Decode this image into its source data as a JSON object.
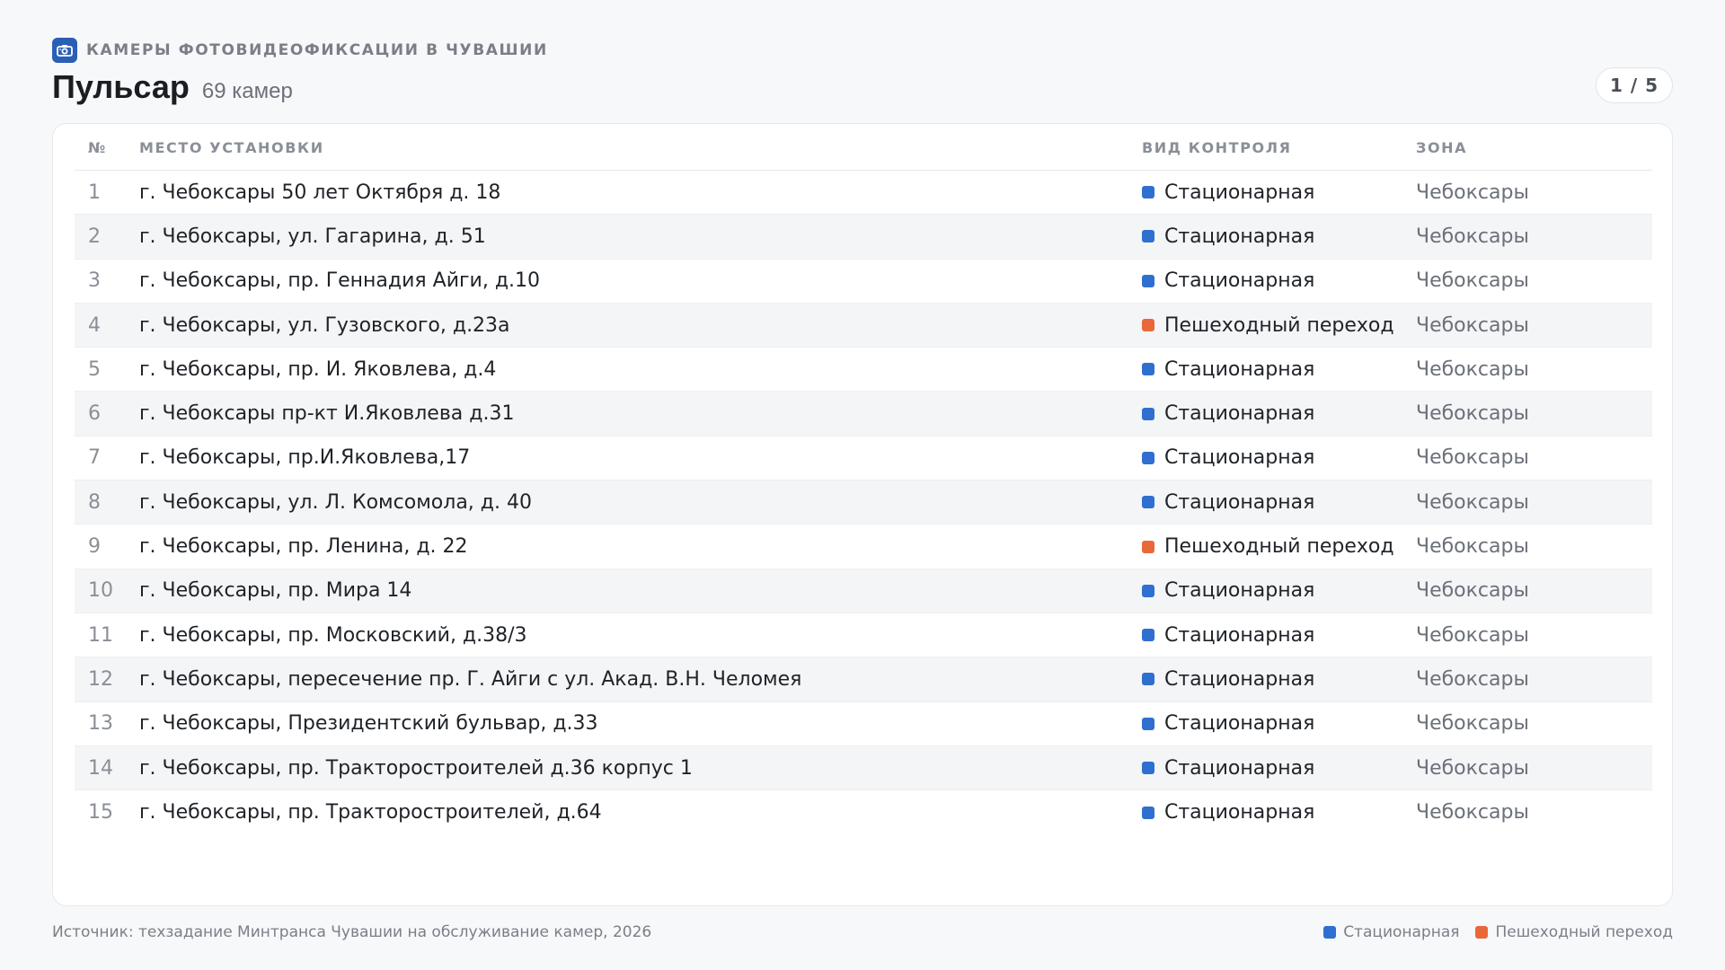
{
  "header": {
    "kicker": "КАМЕРЫ ФОТОВИДЕОФИКСАЦИИ В ЧУВАШИИ",
    "kicker_icon": "camera-icon",
    "title": "Пульсар",
    "count": "69 камер",
    "pager": "1 / 5"
  },
  "colors": {
    "stationary": "#2f6fd0",
    "crossing": "#e8683a",
    "brand": "#2b5fb6"
  },
  "table": {
    "columns": {
      "num": "№",
      "place": "МЕСТО УСТАНОВКИ",
      "type": "ВИД КОНТРОЛЯ",
      "zone": "ЗОНА"
    },
    "rows": [
      {
        "num": "1",
        "place": "г. Чебоксары 50 лет Октября д. 18",
        "type": "Стационарная",
        "kind": "stationary",
        "zone": "Чебоксары"
      },
      {
        "num": "2",
        "place": "г. Чебоксары, ул. Гагарина, д. 51",
        "type": "Стационарная",
        "kind": "stationary",
        "zone": "Чебоксары"
      },
      {
        "num": "3",
        "place": "г. Чебоксары, пр. Геннадия Айги, д.10",
        "type": "Стационарная",
        "kind": "stationary",
        "zone": "Чебоксары"
      },
      {
        "num": "4",
        "place": "г. Чебоксары, ул. Гузовского, д.23а",
        "type": "Пешеходный переход",
        "kind": "crossing",
        "zone": "Чебоксары"
      },
      {
        "num": "5",
        "place": "г. Чебоксары, пр. И. Яковлева, д.4",
        "type": "Стационарная",
        "kind": "stationary",
        "zone": "Чебоксары"
      },
      {
        "num": "6",
        "place": "г. Чебоксары пр-кт И.Яковлева д.31",
        "type": "Стационарная",
        "kind": "stationary",
        "zone": "Чебоксары"
      },
      {
        "num": "7",
        "place": "г. Чебоксары, пр.И.Яковлева,17",
        "type": "Стационарная",
        "kind": "stationary",
        "zone": "Чебоксары"
      },
      {
        "num": "8",
        "place": "г. Чебоксары, ул. Л. Комсомола, д. 40",
        "type": "Стационарная",
        "kind": "stationary",
        "zone": "Чебоксары"
      },
      {
        "num": "9",
        "place": "г. Чебоксары, пр. Ленина, д. 22",
        "type": "Пешеходный переход",
        "kind": "crossing",
        "zone": "Чебоксары"
      },
      {
        "num": "10",
        "place": "г. Чебоксары, пр. Мира 14",
        "type": "Стационарная",
        "kind": "stationary",
        "zone": "Чебоксары"
      },
      {
        "num": "11",
        "place": "г. Чебоксары, пр. Московский, д.38/3",
        "type": "Стационарная",
        "kind": "stationary",
        "zone": "Чебоксары"
      },
      {
        "num": "12",
        "place": "г. Чебоксары, пересечение пр. Г. Айги с ул. Акад. В.Н. Челомея",
        "type": "Стационарная",
        "kind": "stationary",
        "zone": "Чебоксары"
      },
      {
        "num": "13",
        "place": "г. Чебоксары, Президентский бульвар, д.33",
        "type": "Стационарная",
        "kind": "stationary",
        "zone": "Чебоксары"
      },
      {
        "num": "14",
        "place": "г. Чебоксары, пр. Тракторостроителей д.36 корпус 1",
        "type": "Стационарная",
        "kind": "stationary",
        "zone": "Чебоксары"
      },
      {
        "num": "15",
        "place": "г. Чебоксары, пр. Тракторостроителей, д.64",
        "type": "Стационарная",
        "kind": "stationary",
        "zone": "Чебоксары"
      }
    ]
  },
  "footer": {
    "source": "Источник: техзадание Минтранса Чувашии на обслуживание камер, 2026",
    "legend": [
      {
        "label": "Стационарная",
        "kind": "stationary"
      },
      {
        "label": "Пешеходный переход",
        "kind": "crossing"
      }
    ]
  }
}
